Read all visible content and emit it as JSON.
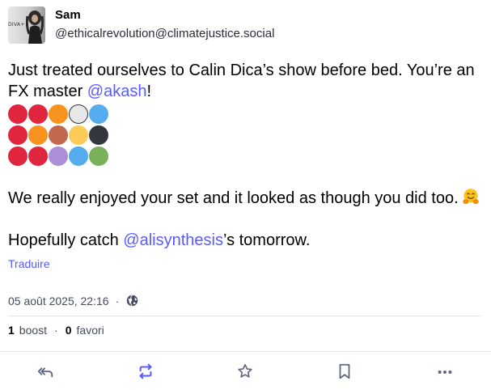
{
  "author": {
    "display_name": "Sam",
    "account": "@ethicalrevolution@climatejustice.social",
    "avatar_text": "DIVA+"
  },
  "content": {
    "line1_prefix": "Just treated ourselves to Calin Dica’s show before bed. You’re an FX master ",
    "mention1": "@akash",
    "line1_suffix": "!",
    "dot_rows": [
      [
        "#e0263f",
        "#e0263f",
        "#f7931e",
        "#e8e8e8",
        "#55acee"
      ],
      [
        "#e0263f",
        "#f7931e",
        "#c1694f",
        "#fdcb58",
        "#31373d"
      ],
      [
        "#e0263f",
        "#e0263f",
        "#aa8ed6",
        "#55acee",
        "#78b159"
      ]
    ],
    "para2": "We really enjoyed your set and it looked as though you did too.",
    "para2_emoji": "hugging-face-emoji",
    "para3_prefix": "Hopefully catch ",
    "mention2": "@alisynthesis",
    "para3_suffix": "’s tomorrow."
  },
  "translate_label": "Traduire",
  "meta": {
    "timestamp": "05 août 2025, 22:16",
    "separator": "·",
    "visibility_icon": "globe-icon"
  },
  "counts": {
    "boosts": "1",
    "boosts_label": "boost",
    "separator": "·",
    "favourites": "0",
    "favourites_label": "favori"
  },
  "actions": [
    {
      "name": "reply-all",
      "icon": "reply-all-icon"
    },
    {
      "name": "boost",
      "icon": "boost-icon",
      "active": true
    },
    {
      "name": "favourite",
      "icon": "star-icon"
    },
    {
      "name": "bookmark",
      "icon": "bookmark-icon"
    },
    {
      "name": "more",
      "icon": "more-icon"
    }
  ],
  "colors": {
    "accent": "#595aff",
    "text_secondary": "#444b5d",
    "icon": "#606984"
  }
}
